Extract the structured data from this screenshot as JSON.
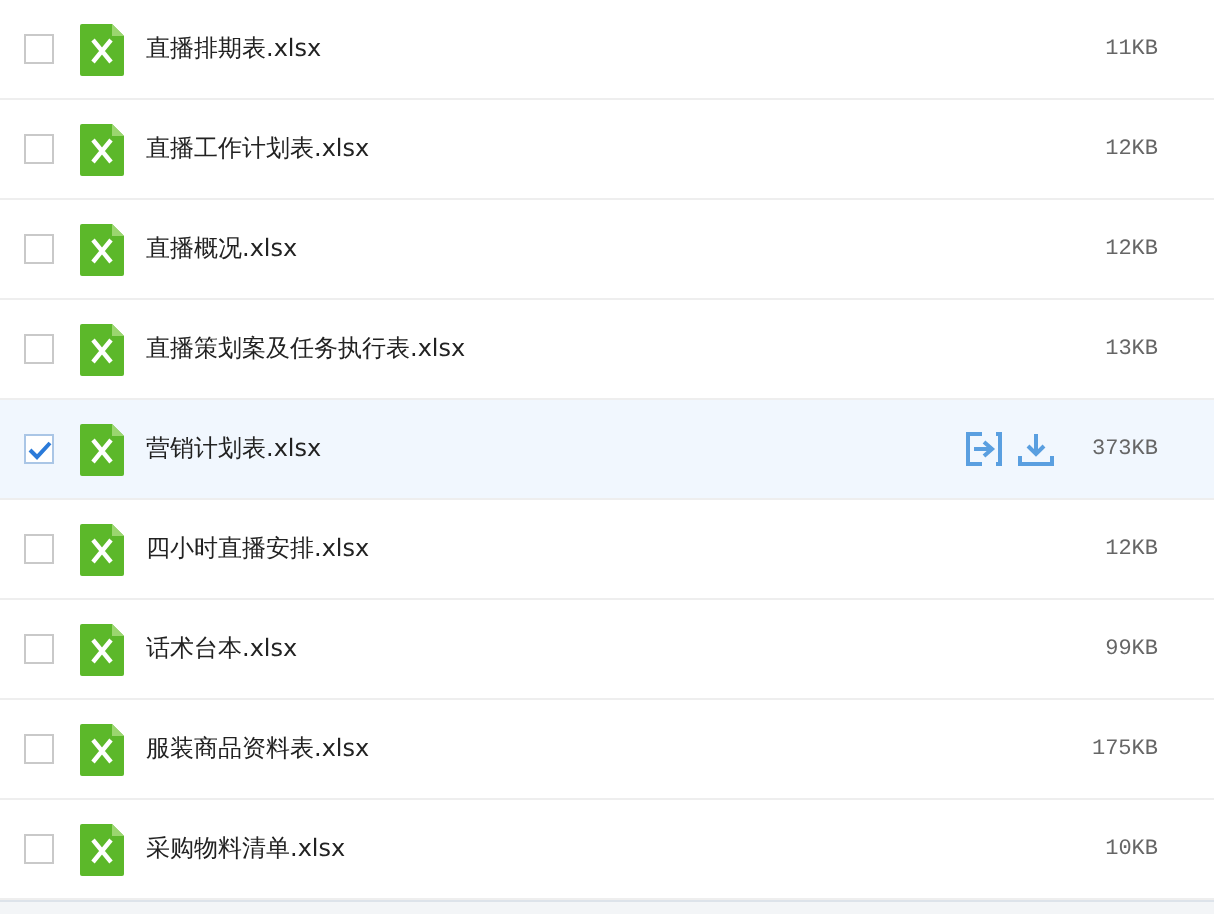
{
  "files": [
    {
      "name": "直播排期表.xlsx",
      "size": "11KB",
      "selected": false,
      "show_actions": false
    },
    {
      "name": "直播工作计划表.xlsx",
      "size": "12KB",
      "selected": false,
      "show_actions": false
    },
    {
      "name": "直播概况.xlsx",
      "size": "12KB",
      "selected": false,
      "show_actions": false
    },
    {
      "name": "直播策划案及任务执行表.xlsx",
      "size": "13KB",
      "selected": false,
      "show_actions": false
    },
    {
      "name": "营销计划表.xlsx",
      "size": "373KB",
      "selected": true,
      "show_actions": true
    },
    {
      "name": "四小时直播安排.xlsx",
      "size": "12KB",
      "selected": false,
      "show_actions": false
    },
    {
      "name": "话术台本.xlsx",
      "size": "99KB",
      "selected": false,
      "show_actions": false
    },
    {
      "name": "服装商品资料表.xlsx",
      "size": "175KB",
      "selected": false,
      "show_actions": false
    },
    {
      "name": "采购物料清单.xlsx",
      "size": "10KB",
      "selected": false,
      "show_actions": false
    }
  ]
}
